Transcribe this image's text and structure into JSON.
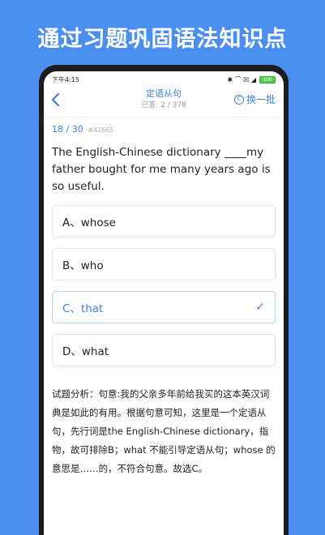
{
  "promo": {
    "title": "通过习题巩固语法知识点"
  },
  "status": {
    "time": "下午4:15",
    "battery": "100",
    "icons": "✱ ⌒ ☒ ◢"
  },
  "nav": {
    "title": "定语从句",
    "answered_label": "已答: 2 / 378",
    "swap_label": "换一批",
    "back_icon": "chevron-left-icon",
    "swap_icon": "refresh-icon"
  },
  "progress": {
    "index": "18 / 30",
    "id": "#42665"
  },
  "question": {
    "text": "The English-Chinese dictionary ____my father bought for me many years ago is so useful."
  },
  "options": [
    {
      "label": "A、whose",
      "selected": false
    },
    {
      "label": "B、who",
      "selected": false
    },
    {
      "label": "C、that",
      "selected": true
    },
    {
      "label": "D、what",
      "selected": false
    }
  ],
  "check_mark": "✓",
  "analysis": {
    "text": "试题分析：句意:我的父亲多年前给我买的这本英汉词典是如此的有用。根据句意可知，这里是一个定语从句，先行词是the English-Chinese dictionary，指物，故可排除B；what 不能引导定语从句；whose 的意思是……的，不符合句意。故选C。"
  },
  "colors": {
    "accent": "#3b83e6",
    "background": "#4a8ff0"
  }
}
